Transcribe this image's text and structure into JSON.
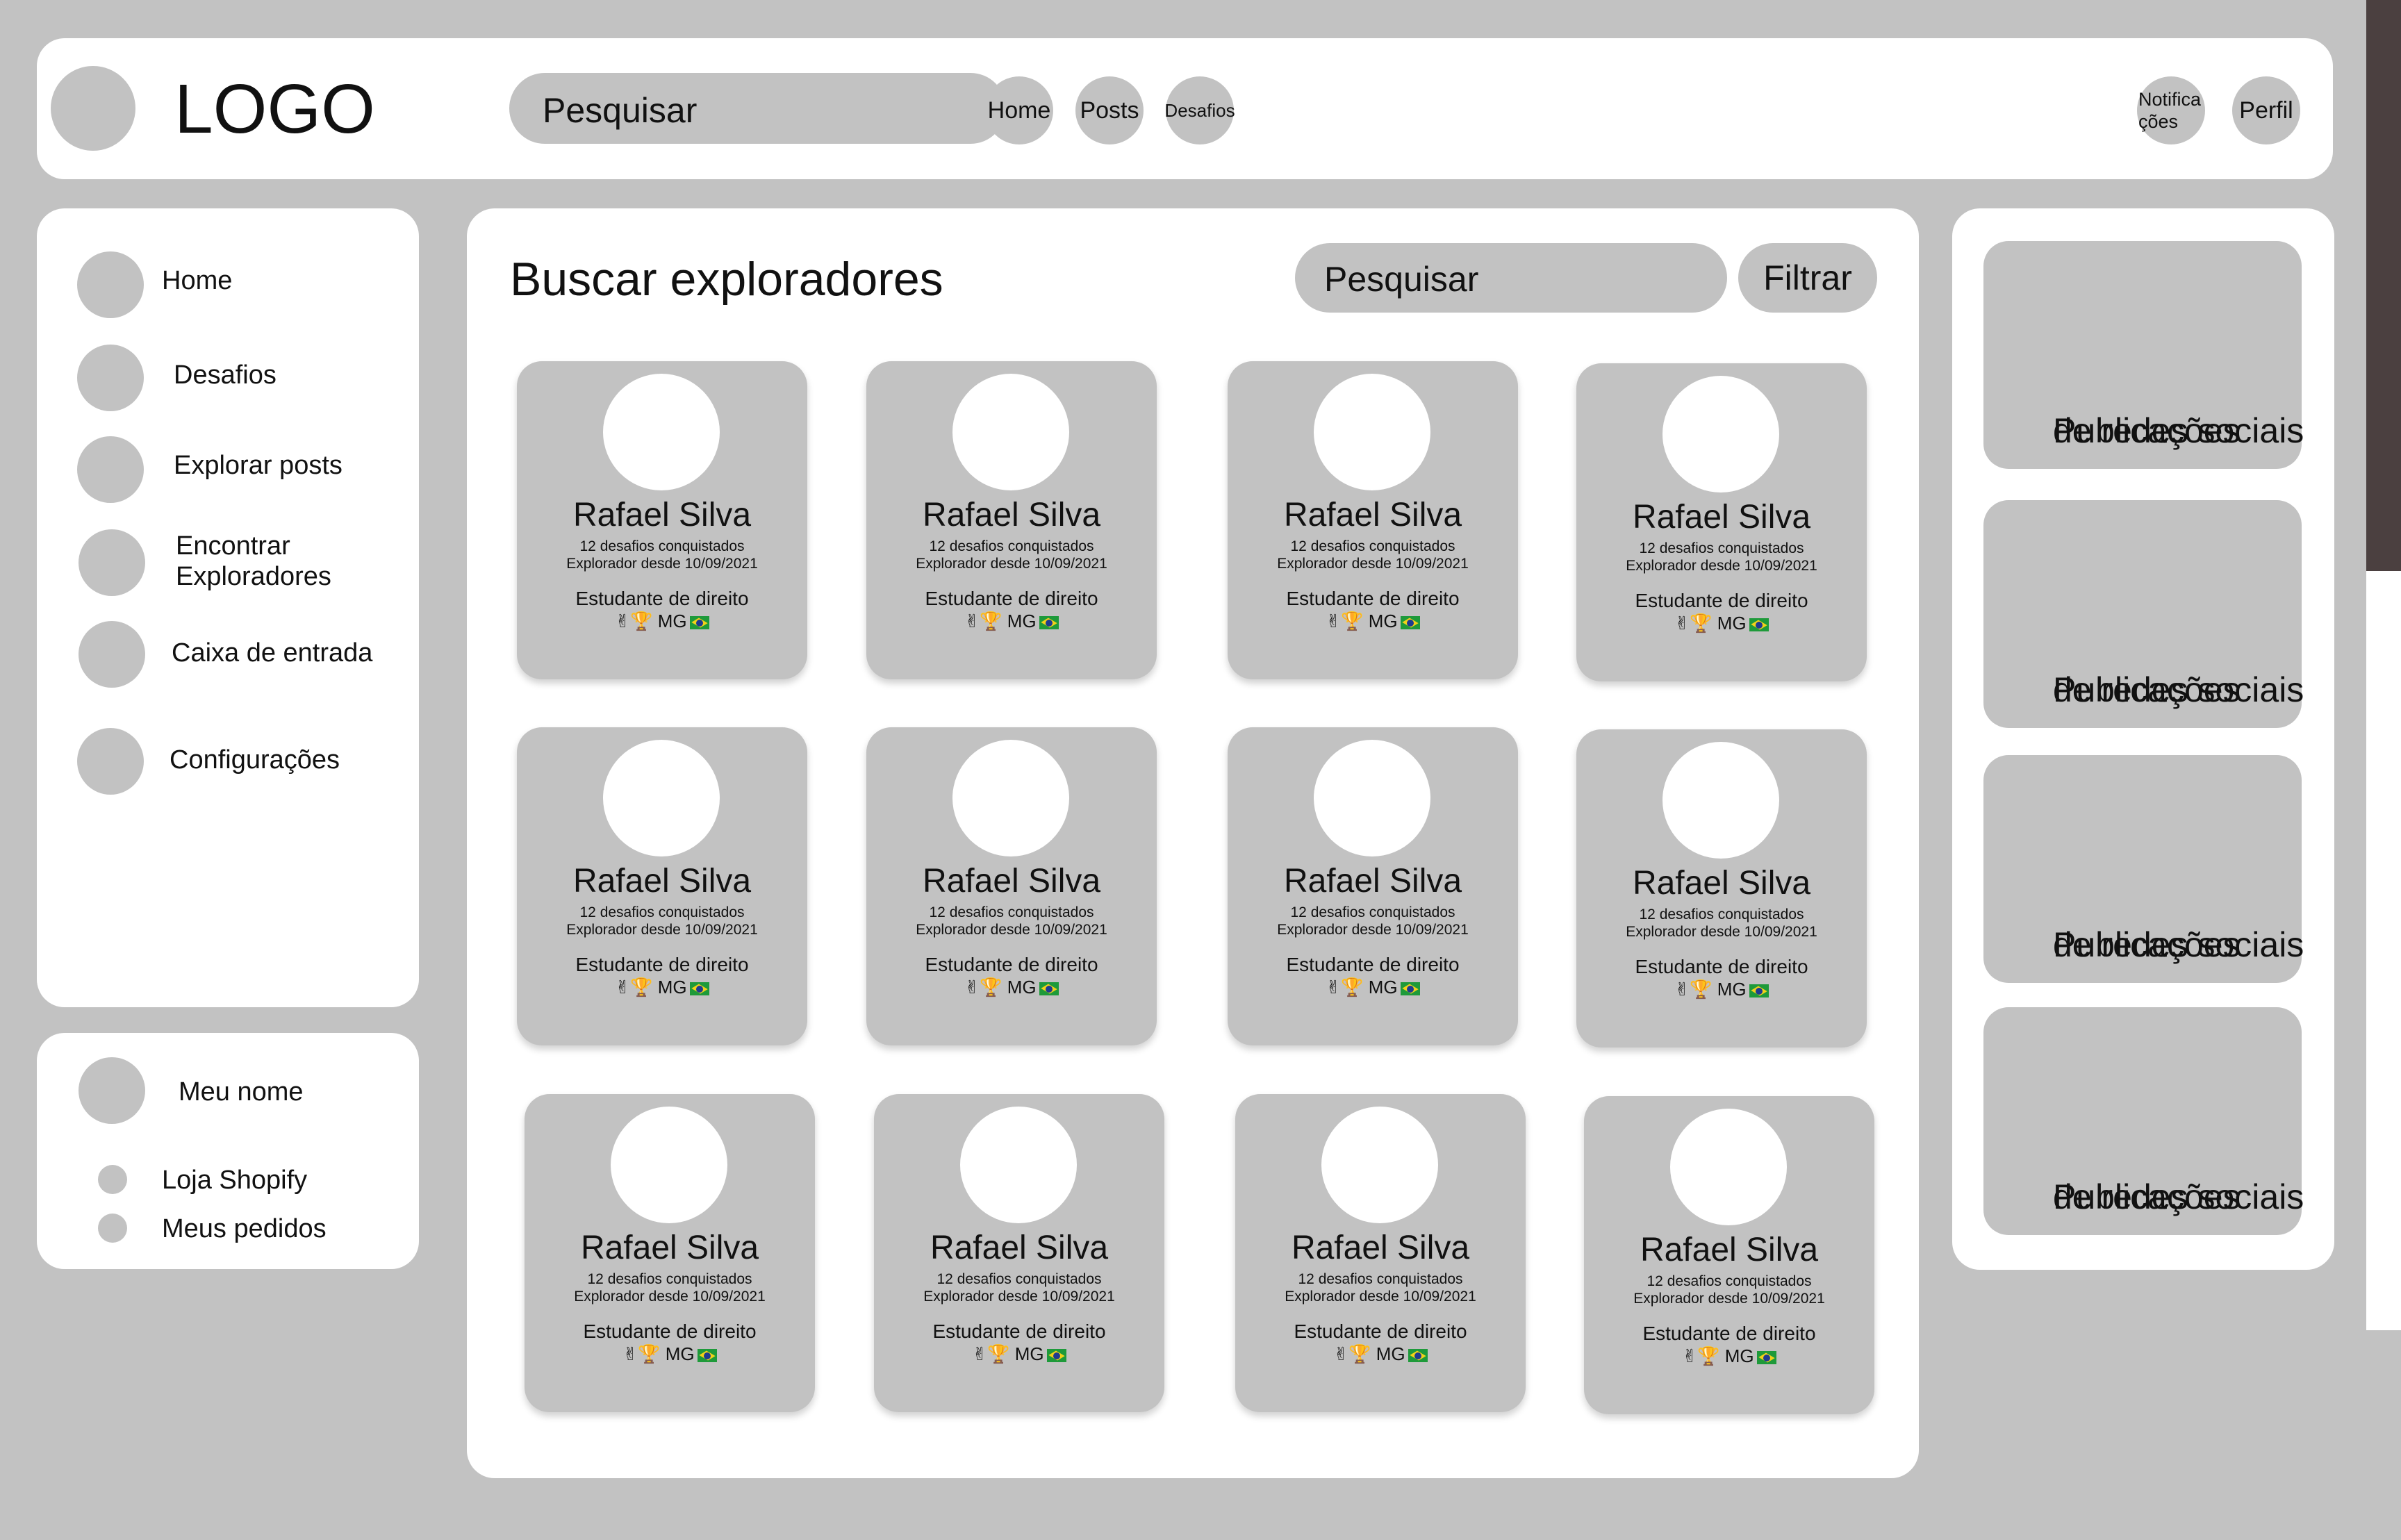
{
  "header": {
    "logo": "LOGO",
    "search_placeholder": "Pesquisar",
    "nav": [
      "Home",
      "Posts",
      "Desafios"
    ],
    "notifications_label_line1": "Notifica",
    "notifications_label_line2": "ções",
    "profile_label": "Perfil"
  },
  "sidebar": {
    "items": [
      {
        "label": "Home"
      },
      {
        "label": "Desafios"
      },
      {
        "label": "Explorar posts"
      },
      {
        "label_line1": "Encontrar",
        "label_line2": "Exploradores"
      },
      {
        "label": "Caixa de entrada"
      },
      {
        "label": "Configurações"
      }
    ]
  },
  "account": {
    "name": "Meu nome",
    "links": [
      "Loja Shopify",
      "Meus pedidos"
    ]
  },
  "main": {
    "title": "Buscar exploradores",
    "search_placeholder": "Pesquisar",
    "filter_label": "Filtrar",
    "cards": [
      {
        "name": "Rafael Silva",
        "challenges": "12 desafios conquistados",
        "since": "Explorador desde 10/09/2021",
        "role": "Estudante de direito",
        "tags": "✌🏆 MG"
      },
      {
        "name": "Rafael Silva",
        "challenges": "12 desafios conquistados",
        "since": "Explorador desde 10/09/2021",
        "role": "Estudante de direito",
        "tags": "✌🏆 MG"
      },
      {
        "name": "Rafael Silva",
        "challenges": "12 desafios conquistados",
        "since": "Explorador desde 10/09/2021",
        "role": "Estudante de direito",
        "tags": "✌🏆 MG"
      },
      {
        "name": "Rafael Silva",
        "challenges": "12 desafios conquistados",
        "since": "Explorador desde 10/09/2021",
        "role": "Estudante de direito",
        "tags": "✌🏆 MG"
      },
      {
        "name": "Rafael Silva",
        "challenges": "12 desafios conquistados",
        "since": "Explorador desde 10/09/2021",
        "role": "Estudante de direito",
        "tags": "✌🏆 MG"
      },
      {
        "name": "Rafael Silva",
        "challenges": "12 desafios conquistados",
        "since": "Explorador desde 10/09/2021",
        "role": "Estudante de direito",
        "tags": "✌🏆 MG"
      },
      {
        "name": "Rafael Silva",
        "challenges": "12 desafios conquistados",
        "since": "Explorador desde 10/09/2021",
        "role": "Estudante de direito",
        "tags": "✌🏆 MG"
      },
      {
        "name": "Rafael Silva",
        "challenges": "12 desafios conquistados",
        "since": "Explorador desde 10/09/2021",
        "role": "Estudante de direito",
        "tags": "✌🏆 MG"
      },
      {
        "name": "Rafael Silva",
        "challenges": "12 desafios conquistados",
        "since": "Explorador desde 10/09/2021",
        "role": "Estudante de direito",
        "tags": "✌🏆 MG"
      },
      {
        "name": "Rafael Silva",
        "challenges": "12 desafios conquistados",
        "since": "Explorador desde 10/09/2021",
        "role": "Estudante de direito",
        "tags": "✌🏆 MG"
      },
      {
        "name": "Rafael Silva",
        "challenges": "12 desafios conquistados",
        "since": "Explorador desde 10/09/2021",
        "role": "Estudante de direito",
        "tags": "✌🏆 MG"
      },
      {
        "name": "Rafael Silva",
        "challenges": "12 desafios conquistados",
        "since": "Explorador desde 10/09/2021",
        "role": "Estudante de direito",
        "tags": "✌🏆 MG"
      }
    ]
  },
  "right": {
    "posts": [
      {
        "line1": "Publicações",
        "line2": "de redes sociais"
      },
      {
        "line1": "Publicações",
        "line2": "de redes sociais"
      },
      {
        "line1": "Publicações",
        "line2": "de redes sociais"
      },
      {
        "line1": "Publicações",
        "line2": "de redes sociais"
      }
    ]
  },
  "colors": {
    "background": "#c2c2c2",
    "panel": "#ffffff",
    "scrollbar_thumb": "#4b4040"
  }
}
